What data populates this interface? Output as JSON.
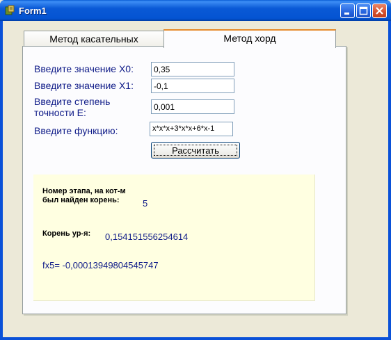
{
  "window": {
    "title": "Form1"
  },
  "tabs": [
    {
      "label": "Метод касательных",
      "active": false
    },
    {
      "label": "Метод хорд",
      "active": true
    }
  ],
  "form": {
    "x0": {
      "label": "Введите значение X0:",
      "value": "0,35"
    },
    "x1": {
      "label": "Введите значение X1:",
      "value": "-0,1"
    },
    "precision": {
      "label_line1": "Введите степень",
      "label_line2": "точности E:",
      "value": "0,001"
    },
    "function": {
      "label": "Введите функцию:",
      "value": "x*x*x+3*x*x+6*x-1"
    },
    "calculate_button": "Рассчитать"
  },
  "result": {
    "step_label_line1": "Номер этапа, на кот-м",
    "step_label_line2": "был найден корень:",
    "step_value": "5",
    "root_label": "Корень ур-я:",
    "root_value": "0,154151556254614",
    "fx_text": "fx5= -0,00013949804545747"
  },
  "colors": {
    "label_text": "#0f1b88",
    "title_bar": "#0a59d6",
    "result_background": "#ffffe1",
    "active_tab_accent": "#e68b2c"
  }
}
